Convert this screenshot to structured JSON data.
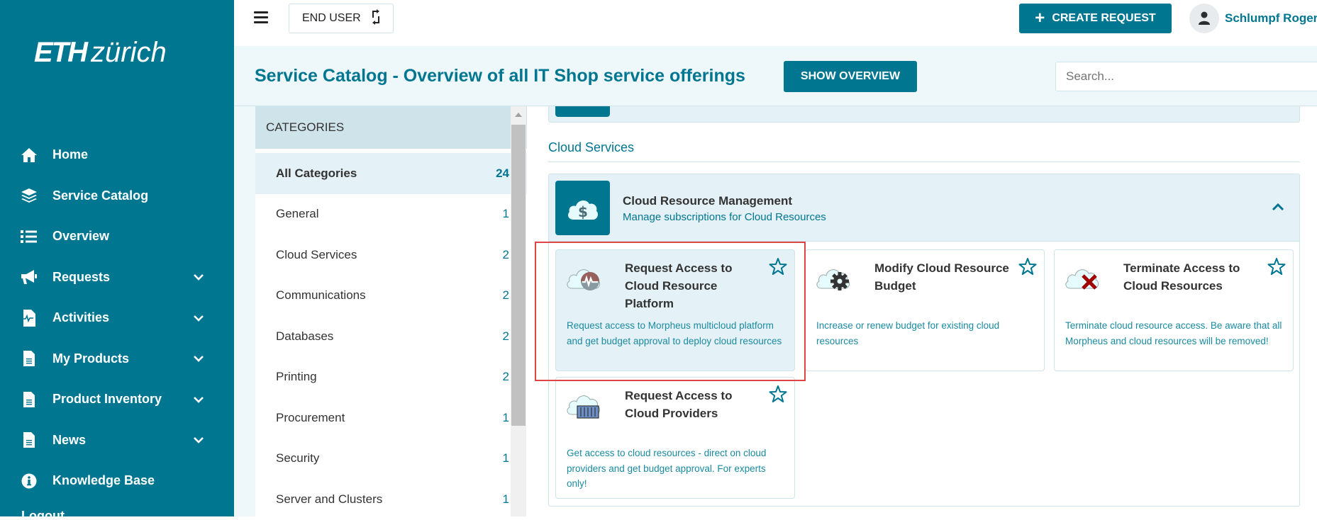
{
  "brand": {
    "eth": "ETH",
    "zurich": "zürich"
  },
  "sidebar": {
    "items": [
      {
        "label": "Home",
        "icon": "home-icon",
        "expandable": false
      },
      {
        "label": "Service Catalog",
        "icon": "layers-icon",
        "expandable": false
      },
      {
        "label": "Overview",
        "icon": "list-icon",
        "expandable": false
      },
      {
        "label": "Requests",
        "icon": "megaphone-icon",
        "expandable": true
      },
      {
        "label": "Activities",
        "icon": "file-pulse-icon",
        "expandable": true
      },
      {
        "label": "My Products",
        "icon": "document-icon",
        "expandable": true
      },
      {
        "label": "Product Inventory",
        "icon": "document-icon",
        "expandable": true
      },
      {
        "label": "News",
        "icon": "document-icon",
        "expandable": true
      },
      {
        "label": "Knowledge Base",
        "icon": "info-icon",
        "expandable": false
      }
    ],
    "logout_peek": "Logout"
  },
  "topbar": {
    "role_label": "END USER",
    "create_label": "CREATE REQUEST",
    "user_name": "Schlumpf Roger"
  },
  "header": {
    "title": "Service Catalog - Overview of all IT Shop service offerings",
    "show_overview_label": "SHOW OVERVIEW",
    "search_placeholder": "Search..."
  },
  "categories": {
    "header": "CATEGORIES",
    "items": [
      {
        "label": "All Categories",
        "count": "24",
        "active": true
      },
      {
        "label": "General",
        "count": "1"
      },
      {
        "label": "Cloud Services",
        "count": "2"
      },
      {
        "label": "Communications",
        "count": "2"
      },
      {
        "label": "Databases",
        "count": "2"
      },
      {
        "label": "Printing",
        "count": "2"
      },
      {
        "label": "Procurement",
        "count": "1"
      },
      {
        "label": "Security",
        "count": "1"
      },
      {
        "label": "Server and Clusters",
        "count": "1"
      }
    ]
  },
  "main": {
    "section_title": "Cloud Services",
    "group": {
      "title": "Cloud Resource Management",
      "subtitle": "Manage subscriptions for Cloud Resources",
      "expanded": true
    },
    "cards": [
      {
        "title": "Request Access to Cloud Resource Platform",
        "description": "Request access to Morpheus multicloud platform and get budget approval to deploy cloud resources",
        "icon": "cloud-morpheus-icon",
        "highlighted": true
      },
      {
        "title": "Modify Cloud Resource Budget",
        "description": "Increase or renew budget for existing cloud resources",
        "icon": "cloud-gear-icon"
      },
      {
        "title": "Terminate Access to Cloud Resources",
        "description": "Terminate cloud resource access. Be aware that all Morpheus and cloud resources will be removed!",
        "icon": "cloud-x-icon"
      },
      {
        "title": "Request Access to Cloud Providers",
        "description": "Get access to cloud resources - direct on cloud providers and get budget approval. For experts only!",
        "icon": "cloud-container-icon"
      }
    ]
  },
  "colors": {
    "brand": "#007690",
    "highlight": "#e04545",
    "panel": "#e4f1f6"
  }
}
